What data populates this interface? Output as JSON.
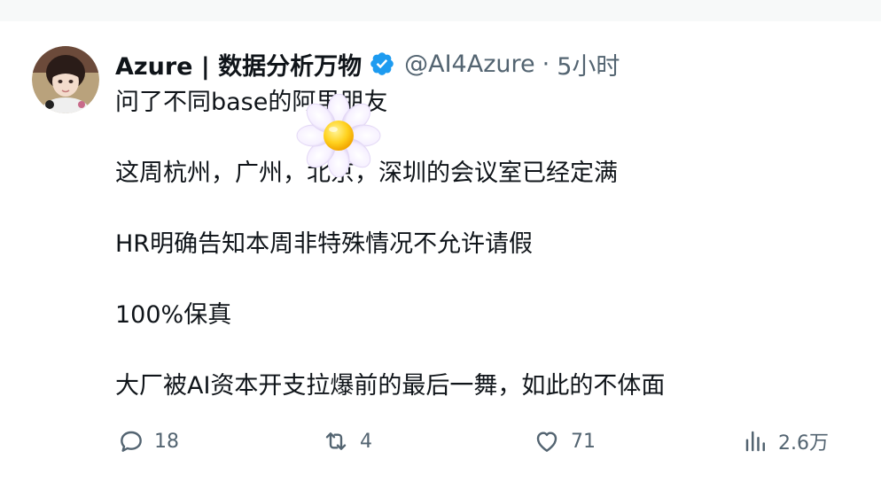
{
  "author": {
    "display_name": "Azure | 数据分析万物",
    "handle": "@AI4Azure",
    "separator": "·",
    "time": "5小时"
  },
  "icons": {
    "verified": "verified-badge-icon",
    "reply": "reply-icon",
    "retweet": "retweet-icon",
    "like": "like-icon",
    "views": "views-icon"
  },
  "colors": {
    "verified_blue": "#1d9bf0",
    "muted": "#536471",
    "text": "#0f1419"
  },
  "body": {
    "line1": "问了不同base的阿里朋友",
    "line2": "这周杭州，广州，北京，深圳的会议室已经定满",
    "line3": "HR明确告知本周非特殊情况不允许请假",
    "line4": "100%保真",
    "line5": "大厂被AI资本开支拉爆前的最后一舞，如此的不体面"
  },
  "actions": {
    "reply_count": "18",
    "retweet_count": "4",
    "like_count": "71",
    "views_count": "2.6万"
  }
}
